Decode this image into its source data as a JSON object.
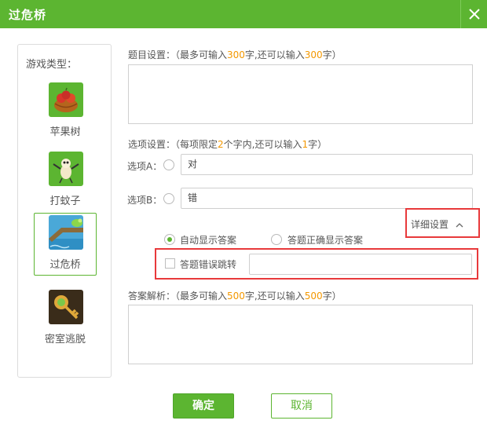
{
  "window": {
    "title": "过危桥"
  },
  "sidebar": {
    "heading": "游戏类型：",
    "items": [
      {
        "label": "苹果树",
        "icon": "apple-basket-icon"
      },
      {
        "label": "打蚊子",
        "icon": "mosquito-icon"
      },
      {
        "label": "过危桥",
        "icon": "bridge-icon",
        "selected": true
      },
      {
        "label": "密室逃脱",
        "icon": "key-icon"
      }
    ]
  },
  "question": {
    "prefix": "题目设置：（最多可输入",
    "max": "300",
    "middle": "字,还可以输入",
    "remaining": "300",
    "suffix": "字）",
    "value": ""
  },
  "options": {
    "hint_prefix": "选项设置：（每项限定",
    "limit": "2",
    "hint_middle": "个字内,还可以输入",
    "remaining": "1",
    "hint_suffix": "字）",
    "a_label": "选项A：",
    "a_value": "对",
    "b_label": "选项B：",
    "b_value": "错"
  },
  "detail": {
    "toggle_label": "详细设置",
    "auto_show_label": "自动显示答案",
    "correct_show_label": "答题正确显示答案",
    "wrong_jump_label": "答题错误跳转",
    "wrong_jump_value": ""
  },
  "analysis": {
    "prefix": "答案解析：（最多可输入",
    "max": "500",
    "middle": "字,还可以输入",
    "remaining": "500",
    "suffix": "字）",
    "value": ""
  },
  "buttons": {
    "confirm": "确定",
    "cancel": "取消"
  },
  "colors": {
    "brand_green": "#5cb531",
    "highlight_orange": "#f39800",
    "annotation_red": "#e8393b"
  }
}
